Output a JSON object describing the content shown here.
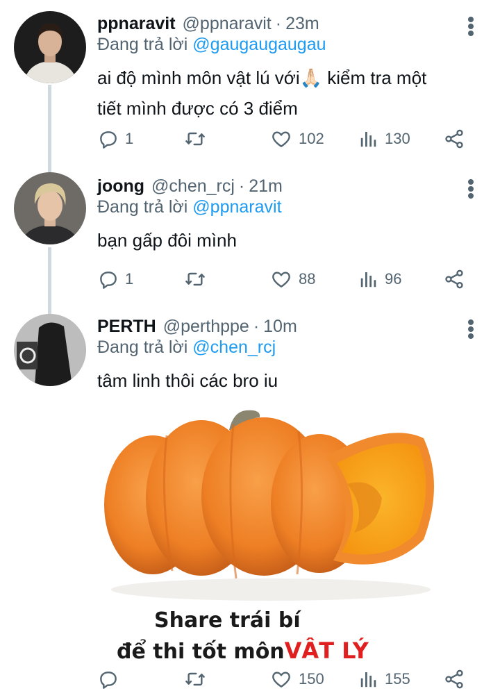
{
  "tweets": [
    {
      "name": "ppnaravit",
      "handle": "@ppnaravit",
      "separator": "·",
      "time": "23m",
      "reply_prefix": "Đang trả lời",
      "reply_to": "@gaugaugaugau",
      "text_line1": "ai độ mình môn vật lú với🙏🏻 kiểm tra một",
      "text_line2": "tiết mình được có 3 điểm",
      "replies": "1",
      "retweets": "",
      "likes": "102",
      "views": "130"
    },
    {
      "name": "joong",
      "handle": "@chen_rcj",
      "separator": "·",
      "time": "21m",
      "reply_prefix": "Đang trả lời",
      "reply_to": "@ppnaravit",
      "text_line1": "bạn gấp đôi mình",
      "replies": "1",
      "retweets": "",
      "likes": "88",
      "views": "96"
    },
    {
      "name": "PERTH",
      "handle": "@perthppe",
      "separator": "·",
      "time": "10m",
      "reply_prefix": "Đang trả lời",
      "reply_to": "@chen_rcj",
      "text_line1": "tâm linh thôi các bro iu",
      "media": {
        "caption_line1": "Share trái bí",
        "caption_line2": "để thi tốt môn",
        "caption_highlight": "VẬT LÝ"
      },
      "replies": "",
      "retweets": "",
      "likes": "150",
      "views": "155"
    }
  ],
  "colors": {
    "text": "#0f1419",
    "secondary": "#536471",
    "link": "#1d9bf0",
    "thread_line": "#cfd9de",
    "caption_highlight": "#e02020",
    "pumpkin": "#f08a2c"
  },
  "icons": [
    "reply-icon",
    "retweet-icon",
    "like-icon",
    "views-icon",
    "share-icon",
    "more-icon"
  ]
}
